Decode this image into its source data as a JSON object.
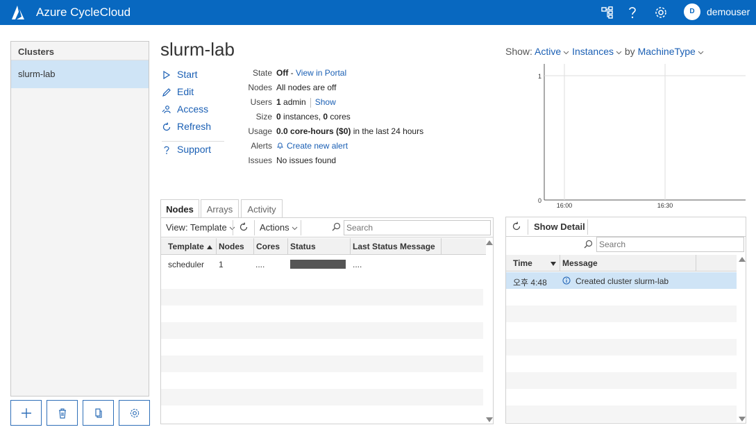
{
  "app": {
    "title": "Azure CycleCloud",
    "username": "demouser",
    "avatar_initial": "D"
  },
  "topbar_icons": [
    "nodes-icon",
    "help-icon",
    "settings-icon"
  ],
  "clusters": {
    "header": "Clusters",
    "items": [
      {
        "name": "slurm-lab",
        "selected": true
      }
    ],
    "buttons": [
      "add-icon",
      "delete-icon",
      "copy-icon",
      "settings-icon"
    ]
  },
  "cluster": {
    "name": "slurm-lab",
    "actions": [
      {
        "label": "Start",
        "icon": "play-icon"
      },
      {
        "label": "Edit",
        "icon": "pencil-icon"
      },
      {
        "label": "Access",
        "icon": "user-key-icon"
      },
      {
        "label": "Refresh",
        "icon": "refresh-icon"
      },
      {
        "label": "Support",
        "icon": "question-icon"
      }
    ],
    "info": {
      "state_label": "State",
      "state_value": "Off",
      "state_sep": " - ",
      "state_link": "View in Portal",
      "nodes_label": "Nodes",
      "nodes_value": "All nodes are off",
      "users_label": "Users",
      "users_count": "1",
      "users_text": " admin",
      "users_link": "Show",
      "size_label": "Size",
      "size_instances": "0",
      "size_instances_text": " instances, ",
      "size_cores": "0",
      "size_cores_text": " cores",
      "usage_label": "Usage",
      "usage_value": "0.0 core-hours ($0)",
      "usage_text": " in the last 24 hours",
      "alerts_label": "Alerts",
      "alerts_link": "Create new alert",
      "issues_label": "Issues",
      "issues_value": "No issues found"
    }
  },
  "show_bar": {
    "prefix": "Show:",
    "filter1": "Active",
    "filter2": "Instances",
    "by": "by",
    "filter3": "MachineType"
  },
  "chart_data": {
    "type": "line",
    "x": [
      "16:00",
      "16:30"
    ],
    "series": [],
    "ylim": [
      0,
      1
    ],
    "yticks": [
      "0",
      "1"
    ],
    "xticks": [
      "16:00",
      "16:30"
    ],
    "grid": true
  },
  "tabs": [
    {
      "label": "Nodes",
      "active": true
    },
    {
      "label": "Arrays",
      "active": false
    },
    {
      "label": "Activity",
      "active": false
    }
  ],
  "nodes": {
    "view_label": "View: Template",
    "actions_label": "Actions",
    "search_placeholder": "Search",
    "columns": [
      "Template",
      "Nodes",
      "Cores",
      "Status",
      "Last Status Message"
    ],
    "rows": [
      {
        "template": "scheduler",
        "nodes": "1",
        "cores": "....",
        "status_progress": 1.0,
        "message": "...."
      }
    ]
  },
  "log": {
    "show_detail": "Show Detail",
    "search_placeholder": "Search",
    "columns": [
      "Time",
      "Message"
    ],
    "rows": [
      {
        "time": "오후 4:48",
        "message": "Created cluster slurm-lab",
        "icon": "info-icon"
      }
    ]
  }
}
